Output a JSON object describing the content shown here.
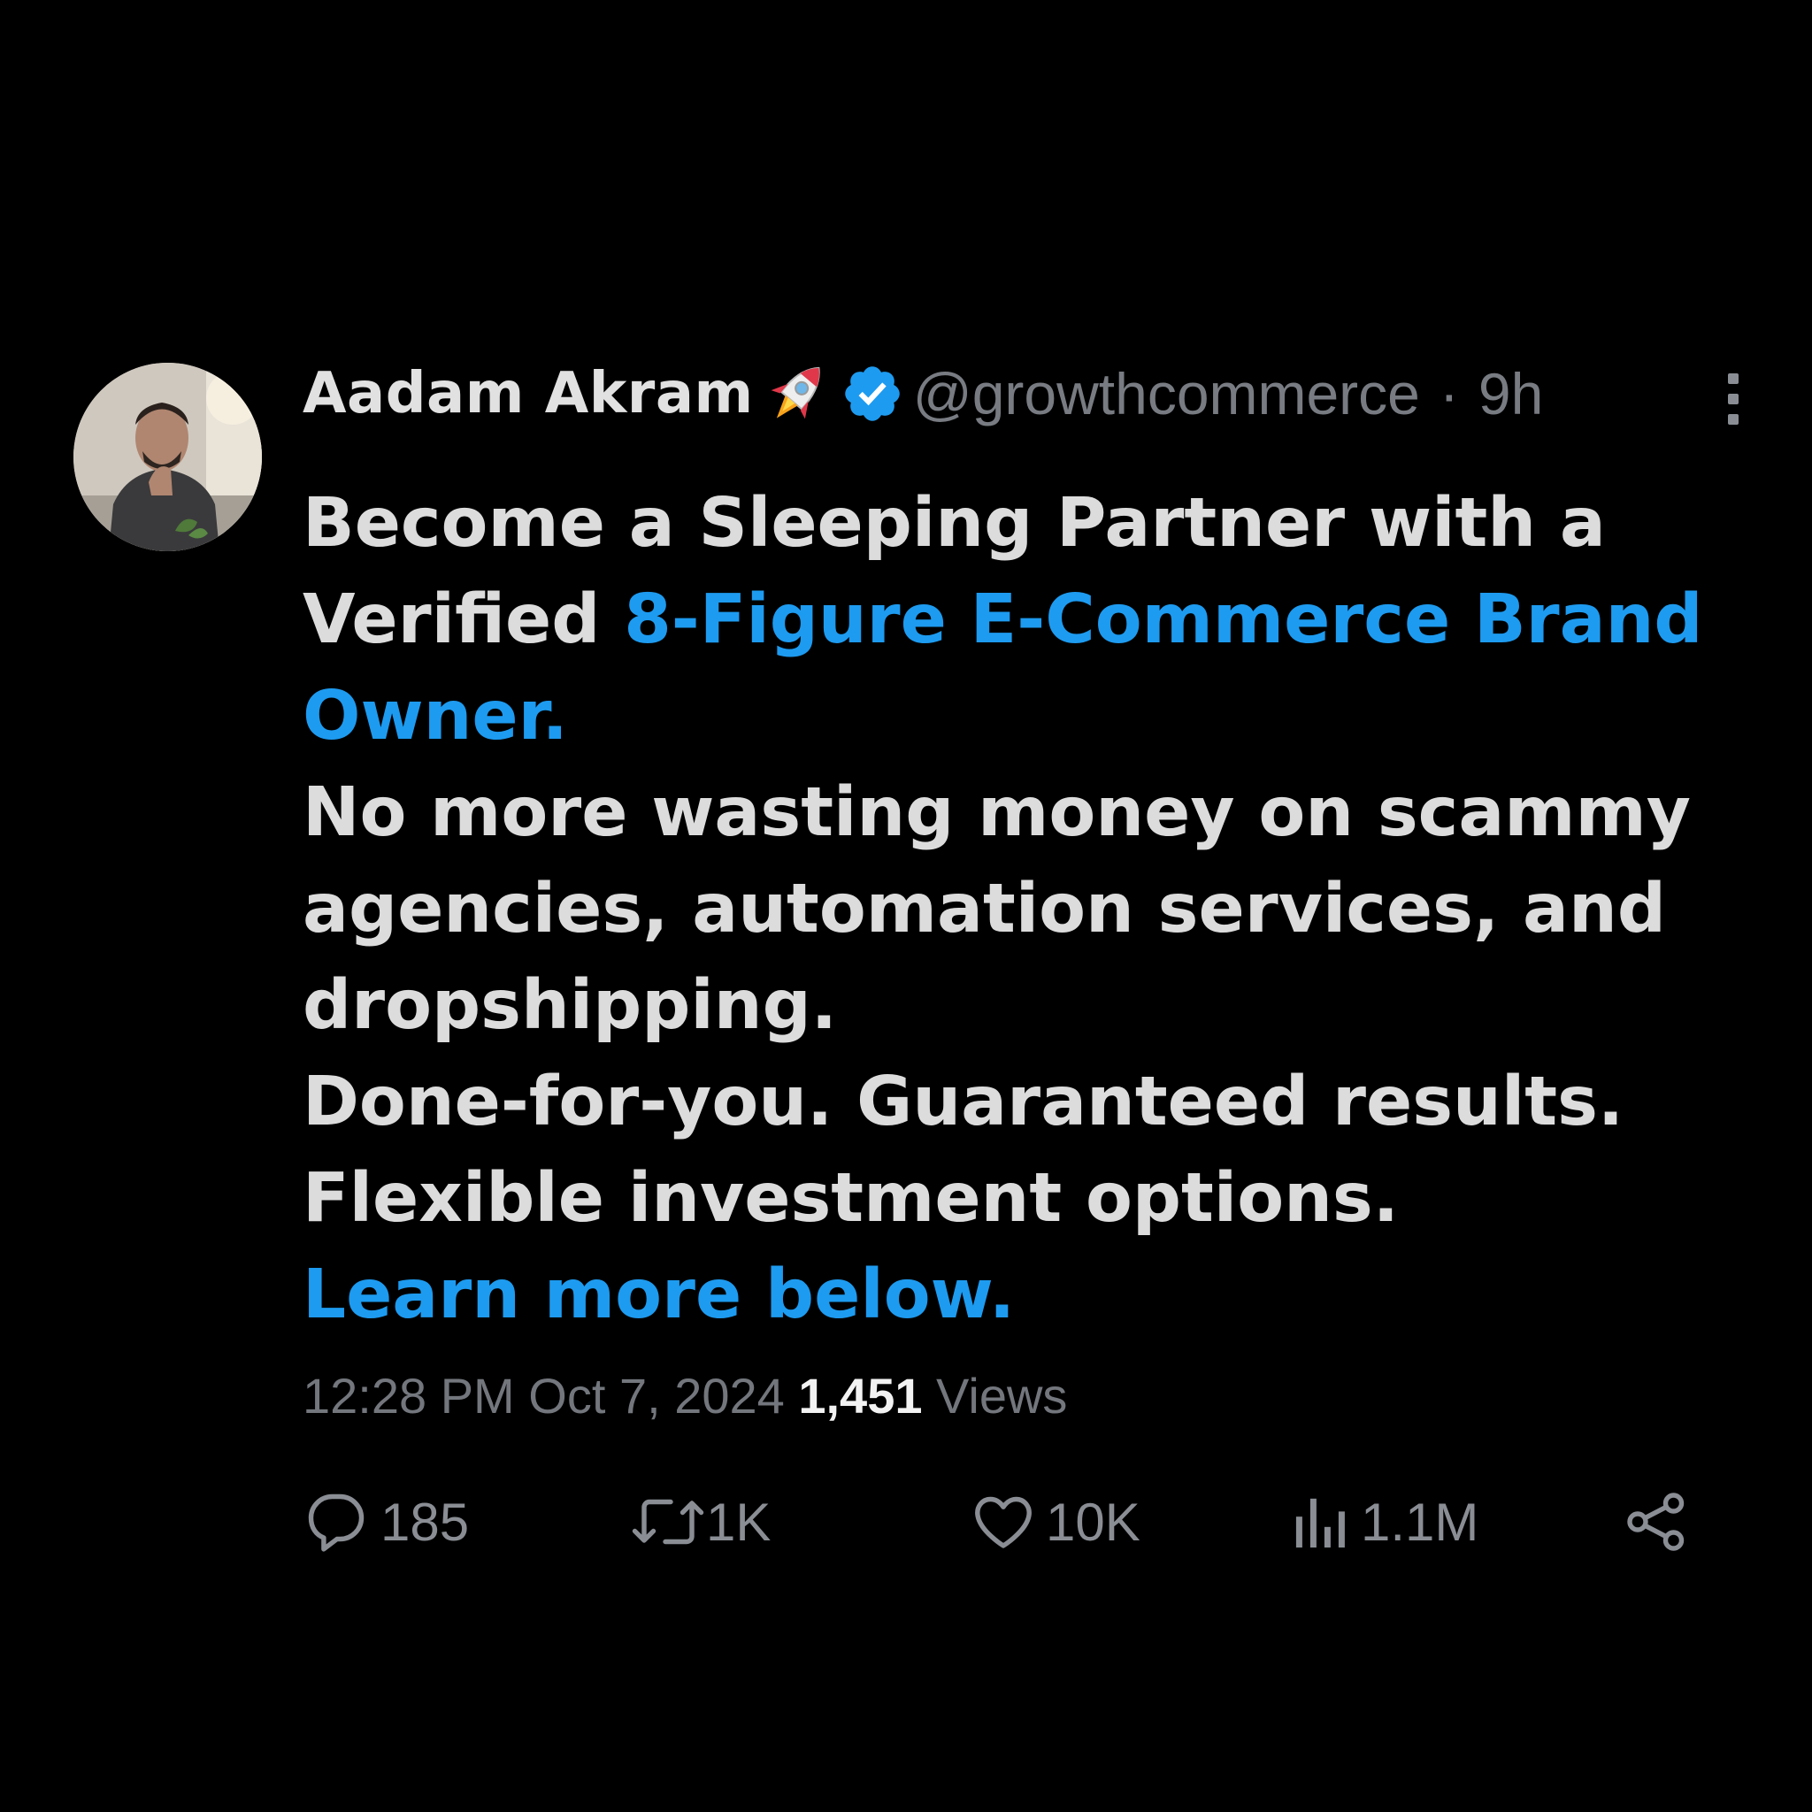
{
  "author": {
    "name": "Aadam Akram",
    "name_emoji": "rocket-icon",
    "verified": true,
    "handle": "@growthcommerce",
    "separator": "·",
    "time_ago": "9h"
  },
  "body": {
    "line1": "Become a Sleeping Partner with a",
    "line2_plain": "Verified ",
    "line2_link": "8-Figure E-Commerce Brand",
    "line3_link": "Owner.",
    "line4": "No more wasting money on scammy",
    "line5": "agencies, automation services, and",
    "line6": "dropshipping.",
    "line7": "Done-for-you. Guaranteed results.",
    "line8": "Flexible investment options.",
    "line9_link": "Learn more below."
  },
  "meta": {
    "time": "12:28 PM",
    "date": "Oct 7, 2024",
    "views_count": "1,451",
    "views_label": "Views"
  },
  "actions": {
    "replies": "185",
    "reposts": "1K",
    "likes": "10K",
    "views": "1.1M"
  },
  "colors": {
    "background": "#000000",
    "text": "#dcdcdc",
    "muted": "#787c82",
    "link": "#1d9bf0",
    "verified": "#1d9bf0"
  }
}
